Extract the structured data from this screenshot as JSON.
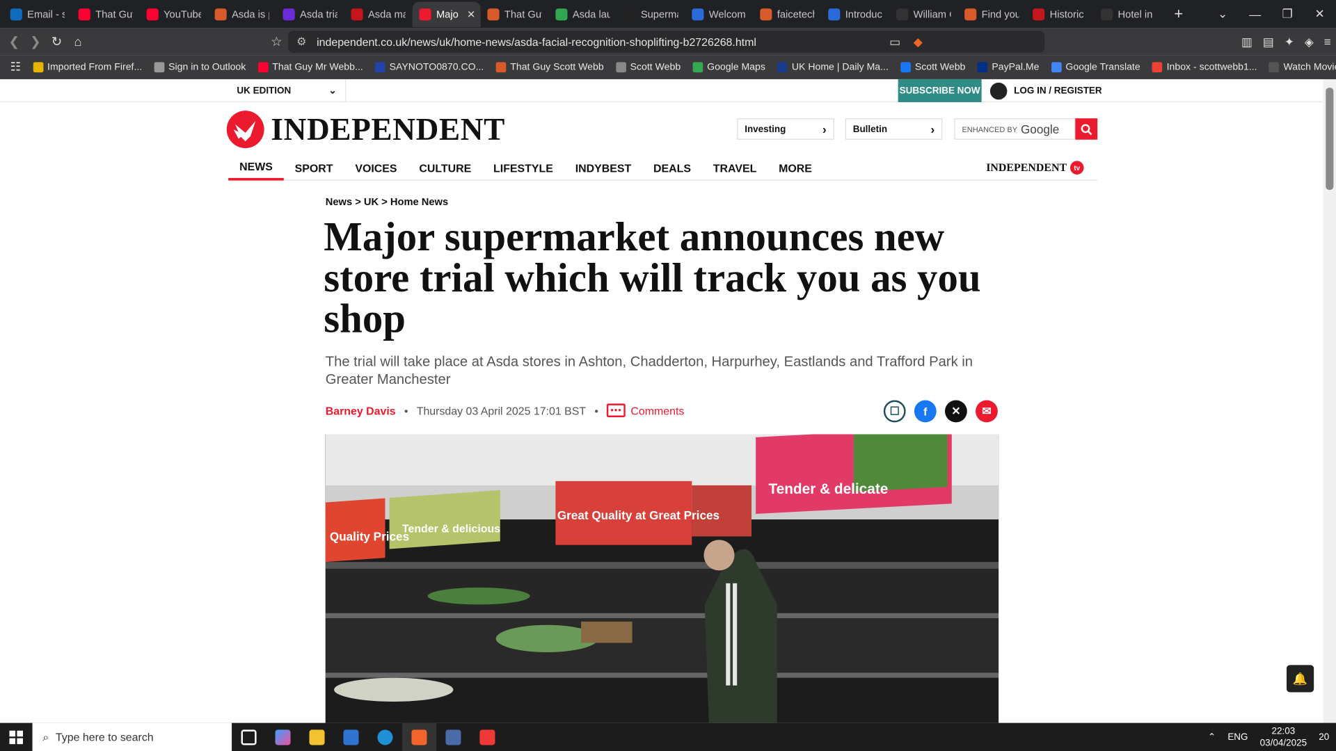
{
  "browser": {
    "tabs": [
      {
        "label": "Email - sc",
        "color": "#0f6cbd"
      },
      {
        "label": "That Guy",
        "color": "#ff0033"
      },
      {
        "label": "YouTube",
        "color": "#ff0033"
      },
      {
        "label": "Asda is p",
        "color": "#d85a2a"
      },
      {
        "label": "Asda trial",
        "color": "#6b2bd9"
      },
      {
        "label": "Asda ma",
        "color": "#c4161c"
      },
      {
        "label": "Majo",
        "color": "#ec1a2e",
        "active": true
      },
      {
        "label": "That Guy",
        "color": "#d85a2a"
      },
      {
        "label": "Asda lau",
        "color": "#2fa84f"
      },
      {
        "label": "Superma",
        "color": "#222222"
      },
      {
        "label": "Welcom",
        "color": "#2a6bd9"
      },
      {
        "label": "faicetech",
        "color": "#d85a2a"
      },
      {
        "label": "Introduc",
        "color": "#2a6bd9"
      },
      {
        "label": "William C",
        "color": "#333333"
      },
      {
        "label": "Find you",
        "color": "#d85a2a"
      },
      {
        "label": "Historic",
        "color": "#c4161c"
      },
      {
        "label": "Hotel in",
        "color": "#333333"
      }
    ],
    "url": "independent.co.uk/news/uk/home-news/asda-facial-recognition-shoplifting-b2726268.html",
    "bookmarks": [
      {
        "label": "Imported From Firef...",
        "color": "#e8b400"
      },
      {
        "label": "Sign in to Outlook",
        "color": "#999999"
      },
      {
        "label": "That Guy Mr Webb...",
        "color": "#ff0033"
      },
      {
        "label": "SAYNOTO0870.CO...",
        "color": "#2244aa"
      },
      {
        "label": "That Guy Scott Webb",
        "color": "#d85a2a"
      },
      {
        "label": "Scott Webb",
        "color": "#888888"
      },
      {
        "label": "Google Maps",
        "color": "#34a853"
      },
      {
        "label": "UK Home | Daily Ma...",
        "color": "#1a3a8a"
      },
      {
        "label": "Scott Webb",
        "color": "#1877f2"
      },
      {
        "label": "PayPal.Me",
        "color": "#003087"
      },
      {
        "label": "Google Translate",
        "color": "#4285f4"
      },
      {
        "label": "Inbox - scottwebb1...",
        "color": "#ea4335"
      },
      {
        "label": "Watch Movies and T...",
        "color": "#555555"
      }
    ]
  },
  "site": {
    "edition": "UK EDITION",
    "subscribe": "SUBSCRIBE NOW",
    "login": "LOG IN / REGISTER",
    "logo": "INDEPENDENT",
    "investing": "Investing",
    "bulletin": "Bulletin",
    "search_label": "ENHANCED BY",
    "search_brand": "Google",
    "nav": [
      "NEWS",
      "SPORT",
      "VOICES",
      "CULTURE",
      "LIFESTYLE",
      "INDYBEST",
      "DEALS",
      "TRAVEL",
      "MORE"
    ],
    "tv_label": "INDEPENDENT",
    "tv_badge": "tv",
    "brand_red": "#ec1a2e"
  },
  "article": {
    "breadcrumb": "News > UK > Home News",
    "headline": "Major supermarket announces new store trial which will track you as you shop",
    "standfirst": "The trial will take place at Asda stores in Ashton, Chadderton, Harpurhey, Eastlands and Trafford Park in Greater Manchester",
    "author": "Barney Davis",
    "date": "Thursday 03 April 2025 17:01 BST",
    "comments": "Comments",
    "hero_signs": [
      "Quality Prices",
      "Tender & delicious",
      "Great Quality at Great Prices",
      "Tender & delicate"
    ]
  },
  "taskbar": {
    "search_placeholder": "Type here to search",
    "lang": "ENG",
    "time": "22:03",
    "date": "03/04/2025",
    "notif": "20"
  }
}
